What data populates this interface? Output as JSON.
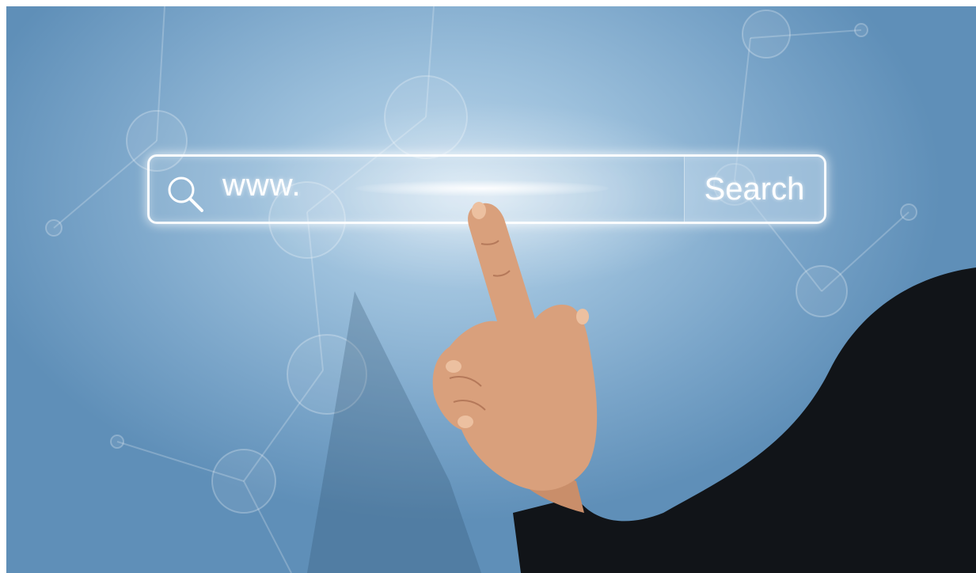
{
  "search_bar": {
    "input_value": "www.",
    "button_label": "Search",
    "icon": "search-icon"
  },
  "colors": {
    "background": "#7aa5c9",
    "glow": "#ffffff",
    "sleeve": "#111418",
    "skin": "#d9a07c"
  }
}
